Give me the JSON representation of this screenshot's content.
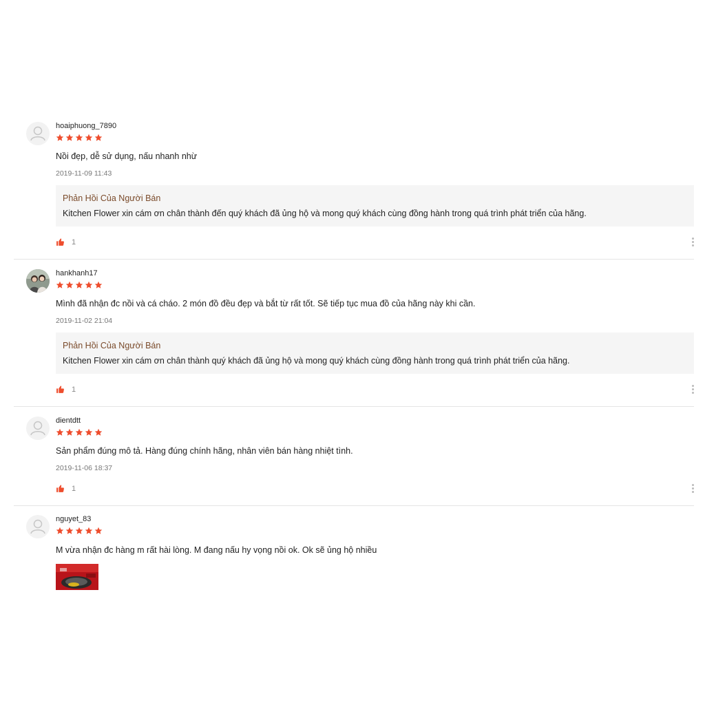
{
  "reviews": [
    {
      "username": "hoaiphuong_7890",
      "rating": 5,
      "comment": "Nồi đẹp, dễ sử dụng, nấu nhanh nhừ",
      "date": "2019-11-09 11:43",
      "reply_title": "Phản Hồi Của Người Bán",
      "reply_text": "Kitchen Flower xin cám ơn chân thành đến quý khách đã ủng hộ và mong quý khách cùng đồng hành trong quá trình phát triển của hãng.",
      "likes": "1"
    },
    {
      "username": "hankhanh17",
      "rating": 5,
      "comment": "Mình đã nhận đc nồi và cá cháo. 2 món đồ đều đẹp và bắt từ rất tốt. Sẽ tiếp tục mua đồ của hãng này khi cần.",
      "date": "2019-11-02 21:04",
      "reply_title": "Phản Hồi Của Người Bán",
      "reply_text": "Kitchen Flower xin cám ơn chân thành quý khách đã ủng hộ và mong quý khách cùng đồng hành trong quá trình phát triển của hãng.",
      "likes": "1"
    },
    {
      "username": "dientdtt",
      "rating": 5,
      "comment": "Sản phẩm đúng mô tả. Hàng đúng chính hãng, nhân viên bán hàng nhiệt tình.",
      "date": "2019-11-06 18:37",
      "likes": "1"
    },
    {
      "username": "nguyet_83",
      "rating": 5,
      "comment": "M vừa nhận đc hàng m rất hài lòng. M đang  nấu hy vọng nồi ok. Ok sẽ ủng hộ nhiều"
    }
  ],
  "colors": {
    "star": "#ee4d2d",
    "like": "#ee4d2d",
    "reply_title": "#7a4a2a",
    "reply_bg": "#f5f5f5"
  },
  "icons": [
    "avatar-placeholder-icon",
    "star-icon",
    "thumbs-up-icon",
    "more-vertical-icon"
  ]
}
